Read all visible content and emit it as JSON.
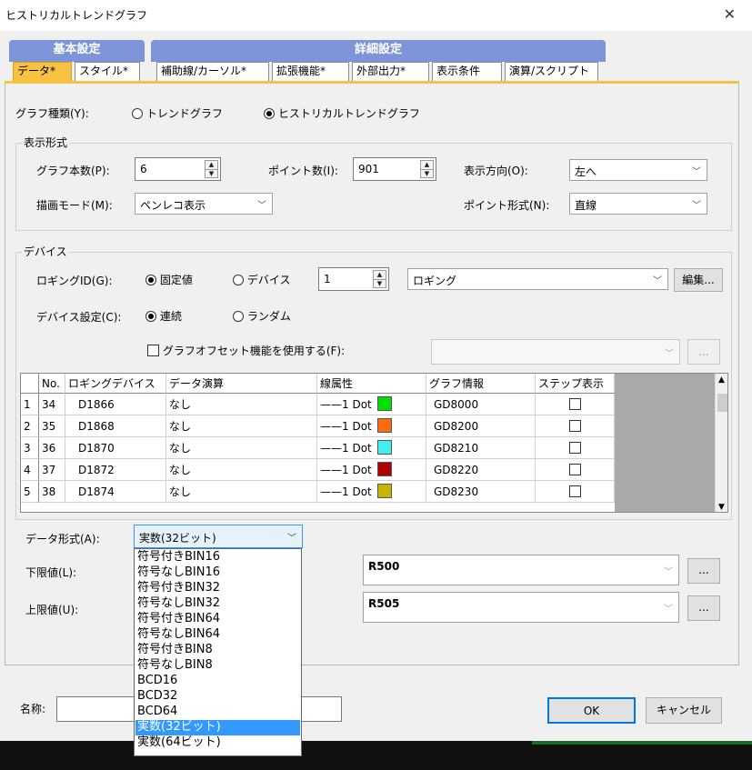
{
  "window": {
    "title": "ヒストリカルトレンドグラフ",
    "close": "✕"
  },
  "tabs": {
    "group_main": "基本設定",
    "group_detail": "詳細設定",
    "items": [
      "データ*",
      "スタイル*",
      "補助線/カーソル*",
      "拡張機能*",
      "外部出力*",
      "表示条件",
      "演算/スクリプト"
    ]
  },
  "graph_type": {
    "label": "グラフ種類(Y):",
    "options": [
      "トレンドグラフ",
      "ヒストリカルトレンドグラフ"
    ]
  },
  "display_format": {
    "group_label": "表示形式",
    "graph_count_label": "グラフ本数(P):",
    "graph_count": "6",
    "points_label": "ポイント数(I):",
    "points": "901",
    "direction_label": "表示方向(O):",
    "direction": "左へ",
    "draw_mode_label": "描画モード(M):",
    "draw_mode": "ペンレコ表示",
    "point_format_label": "ポイント形式(N):",
    "point_format": "直線"
  },
  "device": {
    "group_label": "デバイス",
    "logging_id_label": "ロギングID(G):",
    "logging_id_options": [
      "固定値",
      "デバイス"
    ],
    "logging_id_value": "1",
    "logging_select": "ロギング",
    "edit_button": "編集...",
    "device_setting_label": "デバイス設定(C):",
    "device_setting_options": [
      "連続",
      "ランダム"
    ],
    "offset_checkbox": "グラフオフセット機能を使用する(F):",
    "more_button": "..."
  },
  "table": {
    "headers": [
      "No.",
      "ロギングデバイス",
      "データ演算",
      "線属性",
      "グラフ情報",
      "ステップ表示"
    ],
    "rows": [
      {
        "index": "1",
        "no": "34",
        "device": "D1866",
        "calc": "なし",
        "line": "1 Dot",
        "color": "#00e000",
        "info": "GD8000"
      },
      {
        "index": "2",
        "no": "35",
        "device": "D1868",
        "calc": "なし",
        "line": "1 Dot",
        "color": "#ff6a10",
        "info": "GD8200"
      },
      {
        "index": "3",
        "no": "36",
        "device": "D1870",
        "calc": "なし",
        "line": "1 Dot",
        "color": "#40f0f0",
        "info": "GD8210"
      },
      {
        "index": "4",
        "no": "37",
        "device": "D1872",
        "calc": "なし",
        "line": "1 Dot",
        "color": "#b00000",
        "info": "GD8220"
      },
      {
        "index": "5",
        "no": "38",
        "device": "D1874",
        "calc": "なし",
        "line": "1 Dot",
        "color": "#c8b400",
        "info": "GD8230"
      }
    ]
  },
  "data_format": {
    "label": "データ形式(A):",
    "value": "実数(32ビット)",
    "options": [
      "符号付きBIN16",
      "符号なしBIN16",
      "符号付きBIN32",
      "符号なしBIN32",
      "符号付きBIN64",
      "符号なしBIN64",
      "符号付きBIN8",
      "符号なしBIN8",
      "BCD16",
      "BCD32",
      "BCD64",
      "実数(32ビット)",
      "実数(64ビット)"
    ],
    "selected_index": 11
  },
  "limits": {
    "lower_label": "下限値(L):",
    "lower_value": "R500",
    "upper_label": "上限値(U):",
    "upper_value": "R505",
    "more": "..."
  },
  "footer": {
    "name_label": "名称:",
    "name_value": "",
    "ok": "OK",
    "cancel": "キャンセル"
  }
}
